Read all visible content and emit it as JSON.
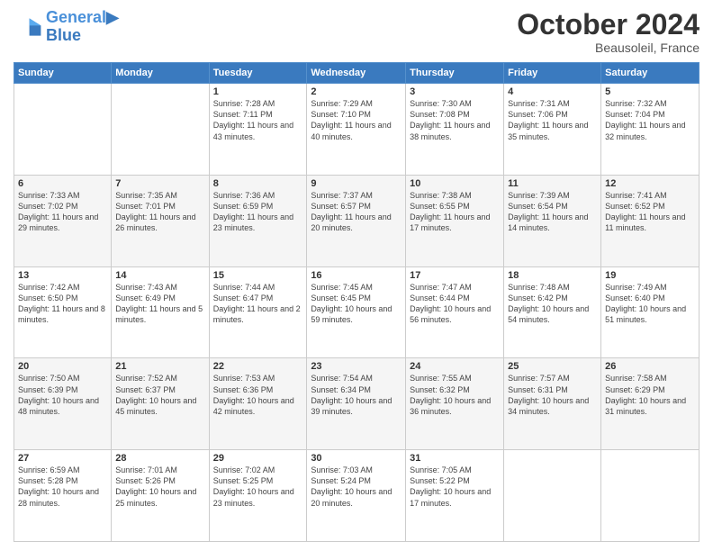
{
  "header": {
    "logo_line1": "General",
    "logo_line2": "Blue",
    "month_year": "October 2024",
    "location": "Beausoleil, France"
  },
  "weekdays": [
    "Sunday",
    "Monday",
    "Tuesday",
    "Wednesday",
    "Thursday",
    "Friday",
    "Saturday"
  ],
  "weeks": [
    [
      {
        "day": "",
        "sunrise": "",
        "sunset": "",
        "daylight": ""
      },
      {
        "day": "",
        "sunrise": "",
        "sunset": "",
        "daylight": ""
      },
      {
        "day": "1",
        "sunrise": "Sunrise: 7:28 AM",
        "sunset": "Sunset: 7:11 PM",
        "daylight": "Daylight: 11 hours and 43 minutes."
      },
      {
        "day": "2",
        "sunrise": "Sunrise: 7:29 AM",
        "sunset": "Sunset: 7:10 PM",
        "daylight": "Daylight: 11 hours and 40 minutes."
      },
      {
        "day": "3",
        "sunrise": "Sunrise: 7:30 AM",
        "sunset": "Sunset: 7:08 PM",
        "daylight": "Daylight: 11 hours and 38 minutes."
      },
      {
        "day": "4",
        "sunrise": "Sunrise: 7:31 AM",
        "sunset": "Sunset: 7:06 PM",
        "daylight": "Daylight: 11 hours and 35 minutes."
      },
      {
        "day": "5",
        "sunrise": "Sunrise: 7:32 AM",
        "sunset": "Sunset: 7:04 PM",
        "daylight": "Daylight: 11 hours and 32 minutes."
      }
    ],
    [
      {
        "day": "6",
        "sunrise": "Sunrise: 7:33 AM",
        "sunset": "Sunset: 7:02 PM",
        "daylight": "Daylight: 11 hours and 29 minutes."
      },
      {
        "day": "7",
        "sunrise": "Sunrise: 7:35 AM",
        "sunset": "Sunset: 7:01 PM",
        "daylight": "Daylight: 11 hours and 26 minutes."
      },
      {
        "day": "8",
        "sunrise": "Sunrise: 7:36 AM",
        "sunset": "Sunset: 6:59 PM",
        "daylight": "Daylight: 11 hours and 23 minutes."
      },
      {
        "day": "9",
        "sunrise": "Sunrise: 7:37 AM",
        "sunset": "Sunset: 6:57 PM",
        "daylight": "Daylight: 11 hours and 20 minutes."
      },
      {
        "day": "10",
        "sunrise": "Sunrise: 7:38 AM",
        "sunset": "Sunset: 6:55 PM",
        "daylight": "Daylight: 11 hours and 17 minutes."
      },
      {
        "day": "11",
        "sunrise": "Sunrise: 7:39 AM",
        "sunset": "Sunset: 6:54 PM",
        "daylight": "Daylight: 11 hours and 14 minutes."
      },
      {
        "day": "12",
        "sunrise": "Sunrise: 7:41 AM",
        "sunset": "Sunset: 6:52 PM",
        "daylight": "Daylight: 11 hours and 11 minutes."
      }
    ],
    [
      {
        "day": "13",
        "sunrise": "Sunrise: 7:42 AM",
        "sunset": "Sunset: 6:50 PM",
        "daylight": "Daylight: 11 hours and 8 minutes."
      },
      {
        "day": "14",
        "sunrise": "Sunrise: 7:43 AM",
        "sunset": "Sunset: 6:49 PM",
        "daylight": "Daylight: 11 hours and 5 minutes."
      },
      {
        "day": "15",
        "sunrise": "Sunrise: 7:44 AM",
        "sunset": "Sunset: 6:47 PM",
        "daylight": "Daylight: 11 hours and 2 minutes."
      },
      {
        "day": "16",
        "sunrise": "Sunrise: 7:45 AM",
        "sunset": "Sunset: 6:45 PM",
        "daylight": "Daylight: 10 hours and 59 minutes."
      },
      {
        "day": "17",
        "sunrise": "Sunrise: 7:47 AM",
        "sunset": "Sunset: 6:44 PM",
        "daylight": "Daylight: 10 hours and 56 minutes."
      },
      {
        "day": "18",
        "sunrise": "Sunrise: 7:48 AM",
        "sunset": "Sunset: 6:42 PM",
        "daylight": "Daylight: 10 hours and 54 minutes."
      },
      {
        "day": "19",
        "sunrise": "Sunrise: 7:49 AM",
        "sunset": "Sunset: 6:40 PM",
        "daylight": "Daylight: 10 hours and 51 minutes."
      }
    ],
    [
      {
        "day": "20",
        "sunrise": "Sunrise: 7:50 AM",
        "sunset": "Sunset: 6:39 PM",
        "daylight": "Daylight: 10 hours and 48 minutes."
      },
      {
        "day": "21",
        "sunrise": "Sunrise: 7:52 AM",
        "sunset": "Sunset: 6:37 PM",
        "daylight": "Daylight: 10 hours and 45 minutes."
      },
      {
        "day": "22",
        "sunrise": "Sunrise: 7:53 AM",
        "sunset": "Sunset: 6:36 PM",
        "daylight": "Daylight: 10 hours and 42 minutes."
      },
      {
        "day": "23",
        "sunrise": "Sunrise: 7:54 AM",
        "sunset": "Sunset: 6:34 PM",
        "daylight": "Daylight: 10 hours and 39 minutes."
      },
      {
        "day": "24",
        "sunrise": "Sunrise: 7:55 AM",
        "sunset": "Sunset: 6:32 PM",
        "daylight": "Daylight: 10 hours and 36 minutes."
      },
      {
        "day": "25",
        "sunrise": "Sunrise: 7:57 AM",
        "sunset": "Sunset: 6:31 PM",
        "daylight": "Daylight: 10 hours and 34 minutes."
      },
      {
        "day": "26",
        "sunrise": "Sunrise: 7:58 AM",
        "sunset": "Sunset: 6:29 PM",
        "daylight": "Daylight: 10 hours and 31 minutes."
      }
    ],
    [
      {
        "day": "27",
        "sunrise": "Sunrise: 6:59 AM",
        "sunset": "Sunset: 5:28 PM",
        "daylight": "Daylight: 10 hours and 28 minutes."
      },
      {
        "day": "28",
        "sunrise": "Sunrise: 7:01 AM",
        "sunset": "Sunset: 5:26 PM",
        "daylight": "Daylight: 10 hours and 25 minutes."
      },
      {
        "day": "29",
        "sunrise": "Sunrise: 7:02 AM",
        "sunset": "Sunset: 5:25 PM",
        "daylight": "Daylight: 10 hours and 23 minutes."
      },
      {
        "day": "30",
        "sunrise": "Sunrise: 7:03 AM",
        "sunset": "Sunset: 5:24 PM",
        "daylight": "Daylight: 10 hours and 20 minutes."
      },
      {
        "day": "31",
        "sunrise": "Sunrise: 7:05 AM",
        "sunset": "Sunset: 5:22 PM",
        "daylight": "Daylight: 10 hours and 17 minutes."
      },
      {
        "day": "",
        "sunrise": "",
        "sunset": "",
        "daylight": ""
      },
      {
        "day": "",
        "sunrise": "",
        "sunset": "",
        "daylight": ""
      }
    ]
  ]
}
